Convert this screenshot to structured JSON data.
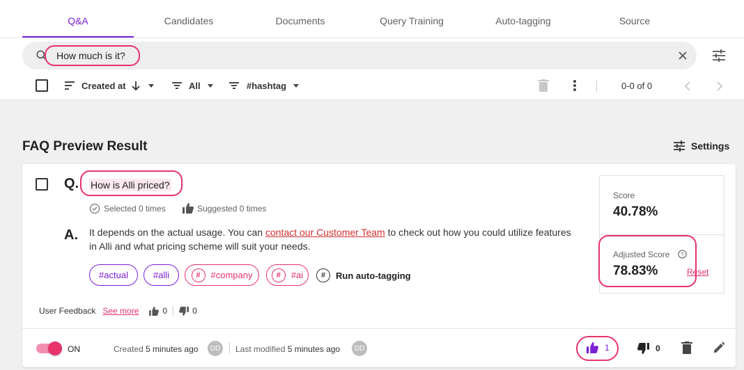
{
  "tabs": [
    {
      "label": "Q&A",
      "active": true
    },
    {
      "label": "Candidates"
    },
    {
      "label": "Documents"
    },
    {
      "label": "Query Training"
    },
    {
      "label": "Auto-tagging"
    },
    {
      "label": "Source"
    }
  ],
  "search": {
    "value": "How much is it?"
  },
  "toolbar": {
    "sort_label": "Created at",
    "filter_label": "All",
    "hashtag_label": "#hashtag",
    "pagination": "0-0 of 0"
  },
  "section": {
    "title": "FAQ Preview Result",
    "settings_label": "Settings"
  },
  "faq": {
    "q_prefix": "Q.",
    "question": "How is Alli priced?",
    "selected": "Selected 0 times",
    "suggested": "Suggested 0 times",
    "a_prefix": "A.",
    "answer_part1": "It depends on the actual usage. You can ",
    "answer_link": "contact our Customer Team",
    "answer_part2": " to check out how you could utilize features in Alli and what pricing scheme will suit your needs.",
    "tags": [
      "#actual",
      "#alli",
      "#company",
      "#ai"
    ],
    "run_autotag": "Run auto-tagging",
    "user_feedback_label": "User Feedback",
    "see_more": "See more",
    "feedback_up": "0",
    "feedback_down": "0"
  },
  "score": {
    "label": "Score",
    "value": "40.78%",
    "adjusted_label": "Adjusted Score",
    "adjusted_value": "78.83%",
    "reset_label": "Reset"
  },
  "footer": {
    "toggle_label": "ON",
    "toggle_on": true,
    "created_label": "Created",
    "created_time": "5 minutes ago",
    "modified_label": "Last modified",
    "modified_time": "5 minutes ago",
    "avatar_initials": "DD",
    "likes": "1",
    "dislikes": "0"
  },
  "colors": {
    "accent": "#7b1fd8",
    "highlight": "#e8336b"
  }
}
